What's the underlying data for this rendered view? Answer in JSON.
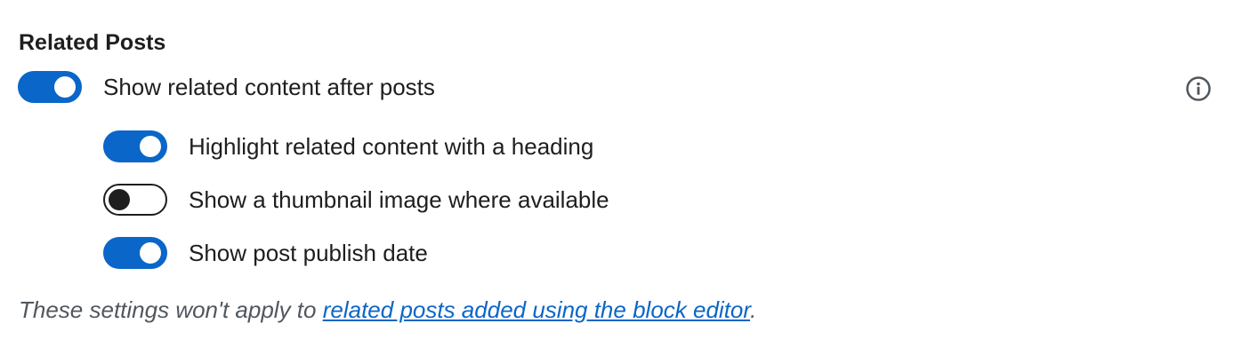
{
  "section": {
    "title": "Related Posts"
  },
  "main_toggle": {
    "label": "Show related content after posts",
    "checked": true
  },
  "sub_toggles": [
    {
      "label": "Highlight related content with a heading",
      "checked": true
    },
    {
      "label": "Show a thumbnail image where available",
      "checked": false
    },
    {
      "label": "Show post publish date",
      "checked": true
    }
  ],
  "info": {
    "icon": "info-icon"
  },
  "note": {
    "prefix": "These settings won't apply to ",
    "link_text": "related posts added using the block editor",
    "suffix": "."
  },
  "colors": {
    "accent": "#0a66c8",
    "text": "#1e1e1e",
    "muted": "#50575e"
  }
}
